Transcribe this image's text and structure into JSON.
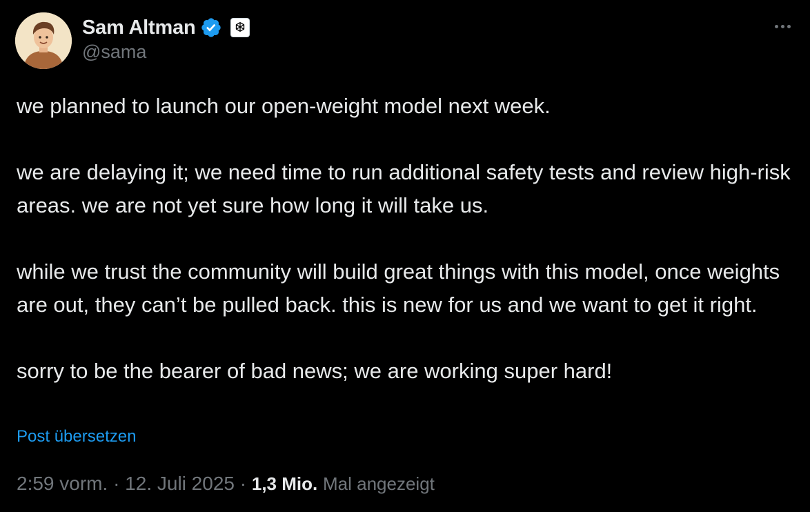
{
  "author": {
    "display_name": "Sam Altman",
    "handle": "@sama",
    "verified_badge_color": "#1d9bf0",
    "verified_icon": "verified-badge-icon",
    "affiliation_icon": "openai-logo-icon"
  },
  "more_icon": "more-options-icon",
  "tweet": {
    "paragraphs": [
      "we planned to launch our open-weight model next week.",
      "we are delaying it; we need time to run additional safety tests and review high-risk areas. we are not yet sure how long it will take us.",
      "while we trust the community will build great things with this model, once weights are out, they can’t be pulled back. this is new for us and we want to get it right.",
      "sorry to be the bearer of bad news; we are working super hard!"
    ],
    "translate_label": "Post übersetzen"
  },
  "meta": {
    "time": "2:59 vorm.",
    "separator": "·",
    "date": "12. Juli 2025",
    "views_count": "1,3 Mio.",
    "views_label": "Mal angezeigt"
  },
  "colors": {
    "background": "#000000",
    "text": "#e7e9ea",
    "secondary": "#71767b",
    "link": "#1d9bf0"
  }
}
